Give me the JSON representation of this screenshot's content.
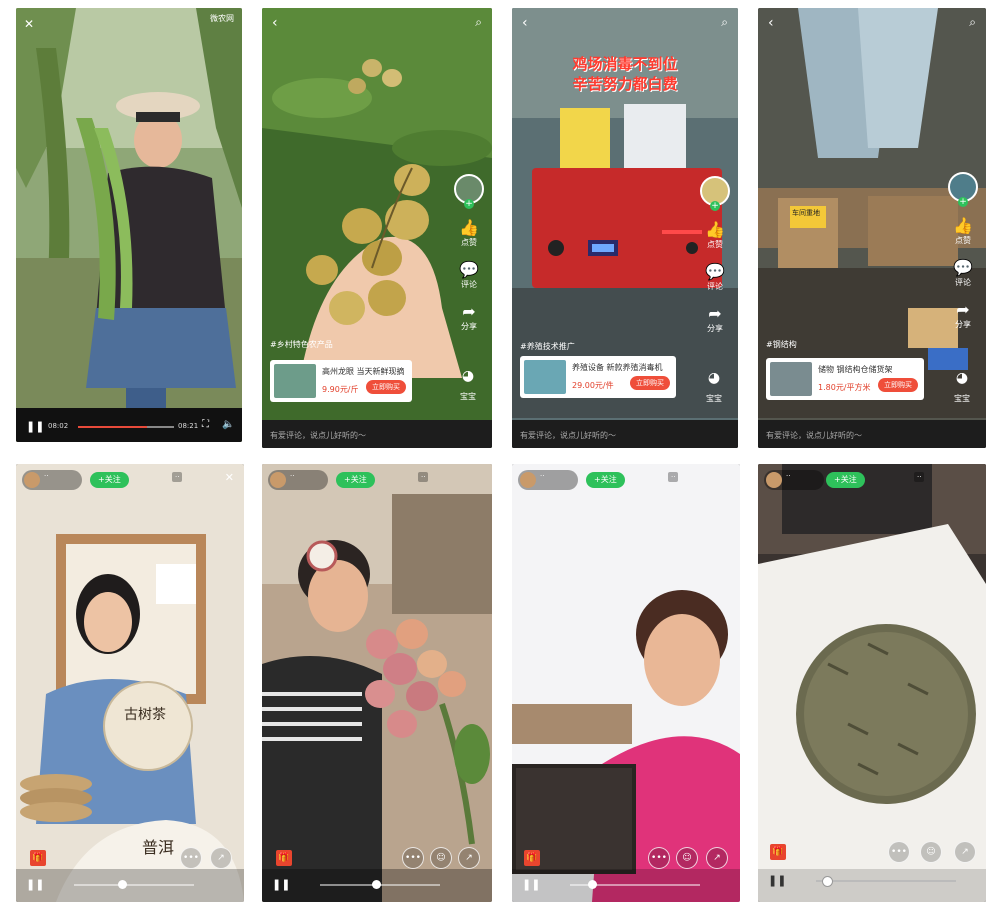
{
  "tile1": {
    "watermark": "微农网",
    "time_current": "08:02",
    "time_total": "08:21",
    "progress": 0.72
  },
  "tile2": {
    "comment_placeholder": "有爱评论，说点儿好听的～",
    "side": {
      "like": "点赞",
      "comment": "评论",
      "share": "分享",
      "baby": "宝宝"
    },
    "product": {
      "title": "高州龙眼  当天新鲜现摘",
      "price": "9.90元/斤",
      "buy": "立即购买"
    },
    "hashtag": "#乡村特色农产品"
  },
  "tile3": {
    "overlay_title_line1": "鸡场消毒不到位",
    "overlay_title_line2": "辛苦努力都白费",
    "comment_placeholder": "有爱评论，说点儿好听的～",
    "side": {
      "like": "点赞",
      "comment": "评论",
      "share": "分享",
      "baby": "宝宝"
    },
    "product": {
      "title": "养殖设备  新款养殖消毒机",
      "price": "29.00元/件",
      "buy": "立即购买"
    },
    "hashtag": "#养殖技术推广"
  },
  "tile4": {
    "sign": "车间重地",
    "comment_placeholder": "有爱评论，说点儿好听的～",
    "side": {
      "like": "点赞",
      "comment": "评论",
      "share": "分享",
      "baby": "宝宝"
    },
    "product": {
      "title": "储物  钢结构仓储货架",
      "price": "1.80元/平方米",
      "buy": "立即购买"
    },
    "hashtag": "#钢结构"
  },
  "tile5": {
    "follow": "+关注",
    "calligraphy": "古树茶",
    "plaque": "普洱"
  },
  "tile6": {
    "follow": "+关注"
  },
  "tile7": {
    "follow": "+关注"
  },
  "tile8": {
    "follow": "+关注"
  },
  "colors": {
    "accent_green": "#2ec15b",
    "buy_red": "#ef4e3a",
    "gift_red": "#e8452e"
  }
}
